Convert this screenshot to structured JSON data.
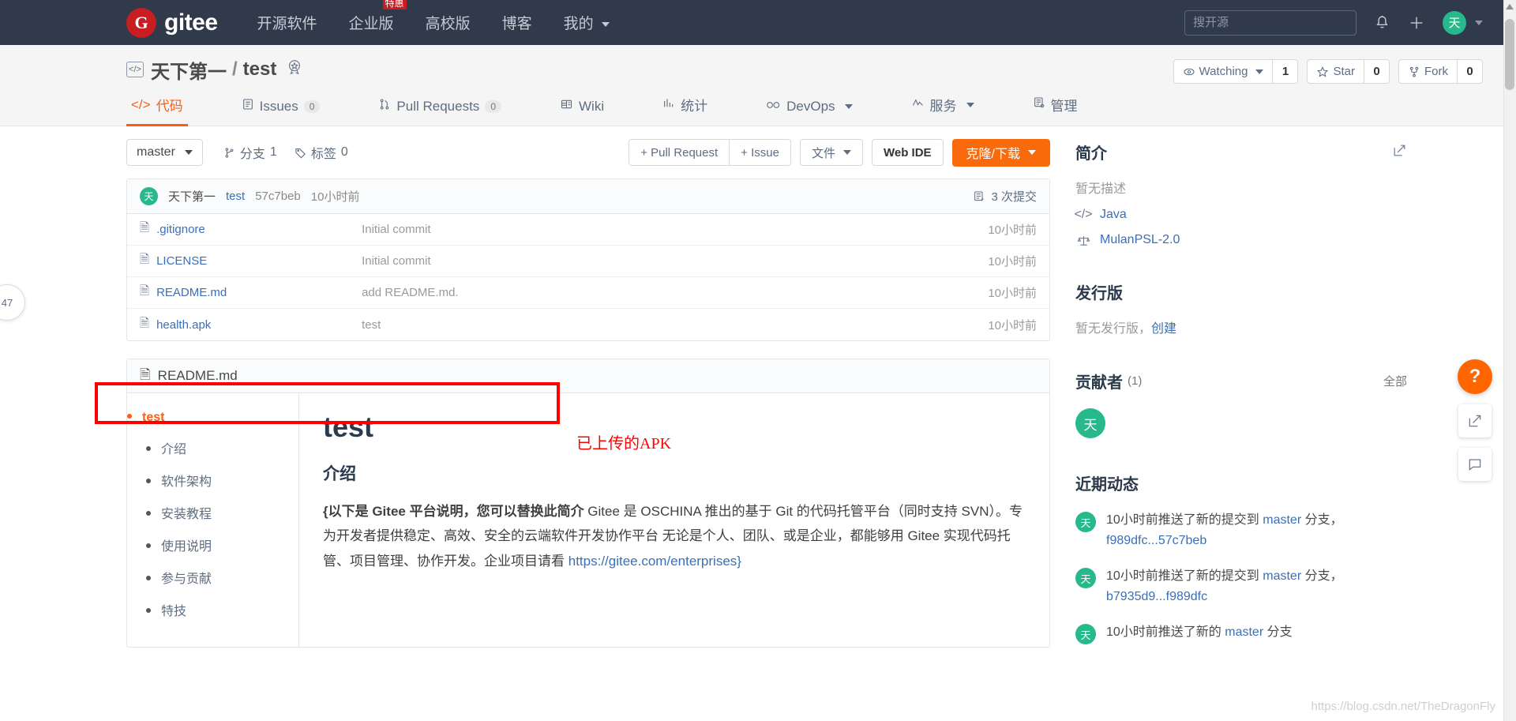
{
  "topnav": {
    "logo_text": "gitee",
    "logo_mark": "G",
    "links": [
      {
        "label": "开源软件",
        "badge": ""
      },
      {
        "label": "企业版",
        "badge": "特惠"
      },
      {
        "label": "高校版",
        "badge": ""
      },
      {
        "label": "博客",
        "badge": ""
      },
      {
        "label": "我的",
        "badge": "",
        "has_caret": true
      }
    ],
    "search_placeholder": "搜开源",
    "search_value": "",
    "bell_icon": "bell-icon",
    "plus_icon": "plus-icon",
    "avatar_initial": "天"
  },
  "repo": {
    "owner": "天下第一",
    "separator": "/",
    "name": "test",
    "code_icon": "</>",
    "medal_icon": "medal-icon",
    "watch_label": "Watching",
    "watch_count": "1",
    "star_label": "Star",
    "star_count": "0",
    "fork_label": "Fork",
    "fork_count": "0"
  },
  "tabs": [
    {
      "label": "代码",
      "icon": "code-icon",
      "count": "",
      "active": true
    },
    {
      "label": "Issues",
      "icon": "issues-icon",
      "count": "0",
      "active": false
    },
    {
      "label": "Pull Requests",
      "icon": "pull-request-icon",
      "count": "0",
      "active": false
    },
    {
      "label": "Wiki",
      "icon": "wiki-icon",
      "count": "",
      "active": false
    },
    {
      "label": "统计",
      "icon": "stats-icon",
      "count": "",
      "active": false
    },
    {
      "label": "DevOps",
      "icon": "infinity-icon",
      "count": "",
      "active": false,
      "caret": true
    },
    {
      "label": "服务",
      "icon": "service-icon",
      "count": "",
      "active": false,
      "caret": true
    },
    {
      "label": "管理",
      "icon": "manage-icon",
      "count": "",
      "active": false
    }
  ],
  "toolbar": {
    "branch": "master",
    "branches_label": "分支",
    "branches_count": "1",
    "tags_label": "标签",
    "tags_count": "0",
    "pull_request_btn": "+ Pull Request",
    "issue_btn": "+ Issue",
    "files_btn": "文件",
    "webide_btn": "Web IDE",
    "clone_btn": "克隆/下载"
  },
  "commit_bar": {
    "avatar_initial": "天",
    "author": "天下第一",
    "message": "test",
    "sha": "57c7beb",
    "time": "10小时前",
    "commits_label": "3 次提交"
  },
  "files": [
    {
      "name": ".gitignore",
      "commit": "Initial commit",
      "time": "10小时前",
      "highlighted": false
    },
    {
      "name": "LICENSE",
      "commit": "Initial commit",
      "time": "10小时前",
      "highlighted": false
    },
    {
      "name": "README.md",
      "commit": "add README.md.",
      "time": "10小时前",
      "highlighted": false
    },
    {
      "name": "health.apk",
      "commit": "test",
      "time": "10小时前",
      "highlighted": true
    }
  ],
  "annotation": {
    "label": "已上传的APK",
    "color": "#ff0000"
  },
  "readme": {
    "title": "README.md",
    "toc": [
      {
        "label": "test",
        "level": 0
      },
      {
        "label": "介绍",
        "level": 1
      },
      {
        "label": "软件架构",
        "level": 1
      },
      {
        "label": "安装教程",
        "level": 1
      },
      {
        "label": "使用说明",
        "level": 1
      },
      {
        "label": "参与贡献",
        "level": 1
      },
      {
        "label": "特技",
        "level": 1
      }
    ],
    "h1": "test",
    "h2": "介绍",
    "body_bold": "{以下是 Gitee 平台说明，您可以替换此简介",
    "body_rest": " Gitee 是 OSCHINA 推出的基于 Git 的代码托管平台（同时支持 SVN）。专为开发者提供稳定、高效、安全的云端软件开发协作平台 无论是个人、团队、或是企业，都能够用 Gitee 实现代码托管、项目管理、协作开发。企业项目请看 ",
    "body_link": "https://gitee.com/enterprises}"
  },
  "sidebar": {
    "intro_title": "简介",
    "intro_edit_icon": "edit-icon",
    "intro_empty": "暂无描述",
    "language": "Java",
    "language_icon": "code-icon",
    "license": "MulanPSL-2.0",
    "license_icon": "scale-icon",
    "release_title": "发行版",
    "release_empty": "暂无发行版，",
    "release_create": "创建",
    "contributors_title": "贡献者",
    "contributors_count": "(1)",
    "contributors_all": "全部",
    "contributor_avatar": "天",
    "activity_title": "近期动态",
    "activities": [
      {
        "avatar": "天",
        "prefix": "10小时前推送了新的提交到 ",
        "branch": "master",
        "suffix": " 分支，",
        "sha": "f989dfc...57c7beb"
      },
      {
        "avatar": "天",
        "prefix": "10小时前推送了新的提交到 ",
        "branch": "master",
        "suffix": " 分支，",
        "sha": "b7935d9...f989dfc"
      },
      {
        "avatar": "天",
        "prefix": "10小时前推送了新的 ",
        "branch": "master",
        "suffix": " 分支",
        "sha": ""
      }
    ]
  },
  "floating": {
    "help_icon": "?",
    "feedback_icon": "feedback-icon",
    "comment_icon": "comment-icon",
    "left_badge": "47"
  },
  "watermark": "https://blog.csdn.net/TheDragonFly"
}
